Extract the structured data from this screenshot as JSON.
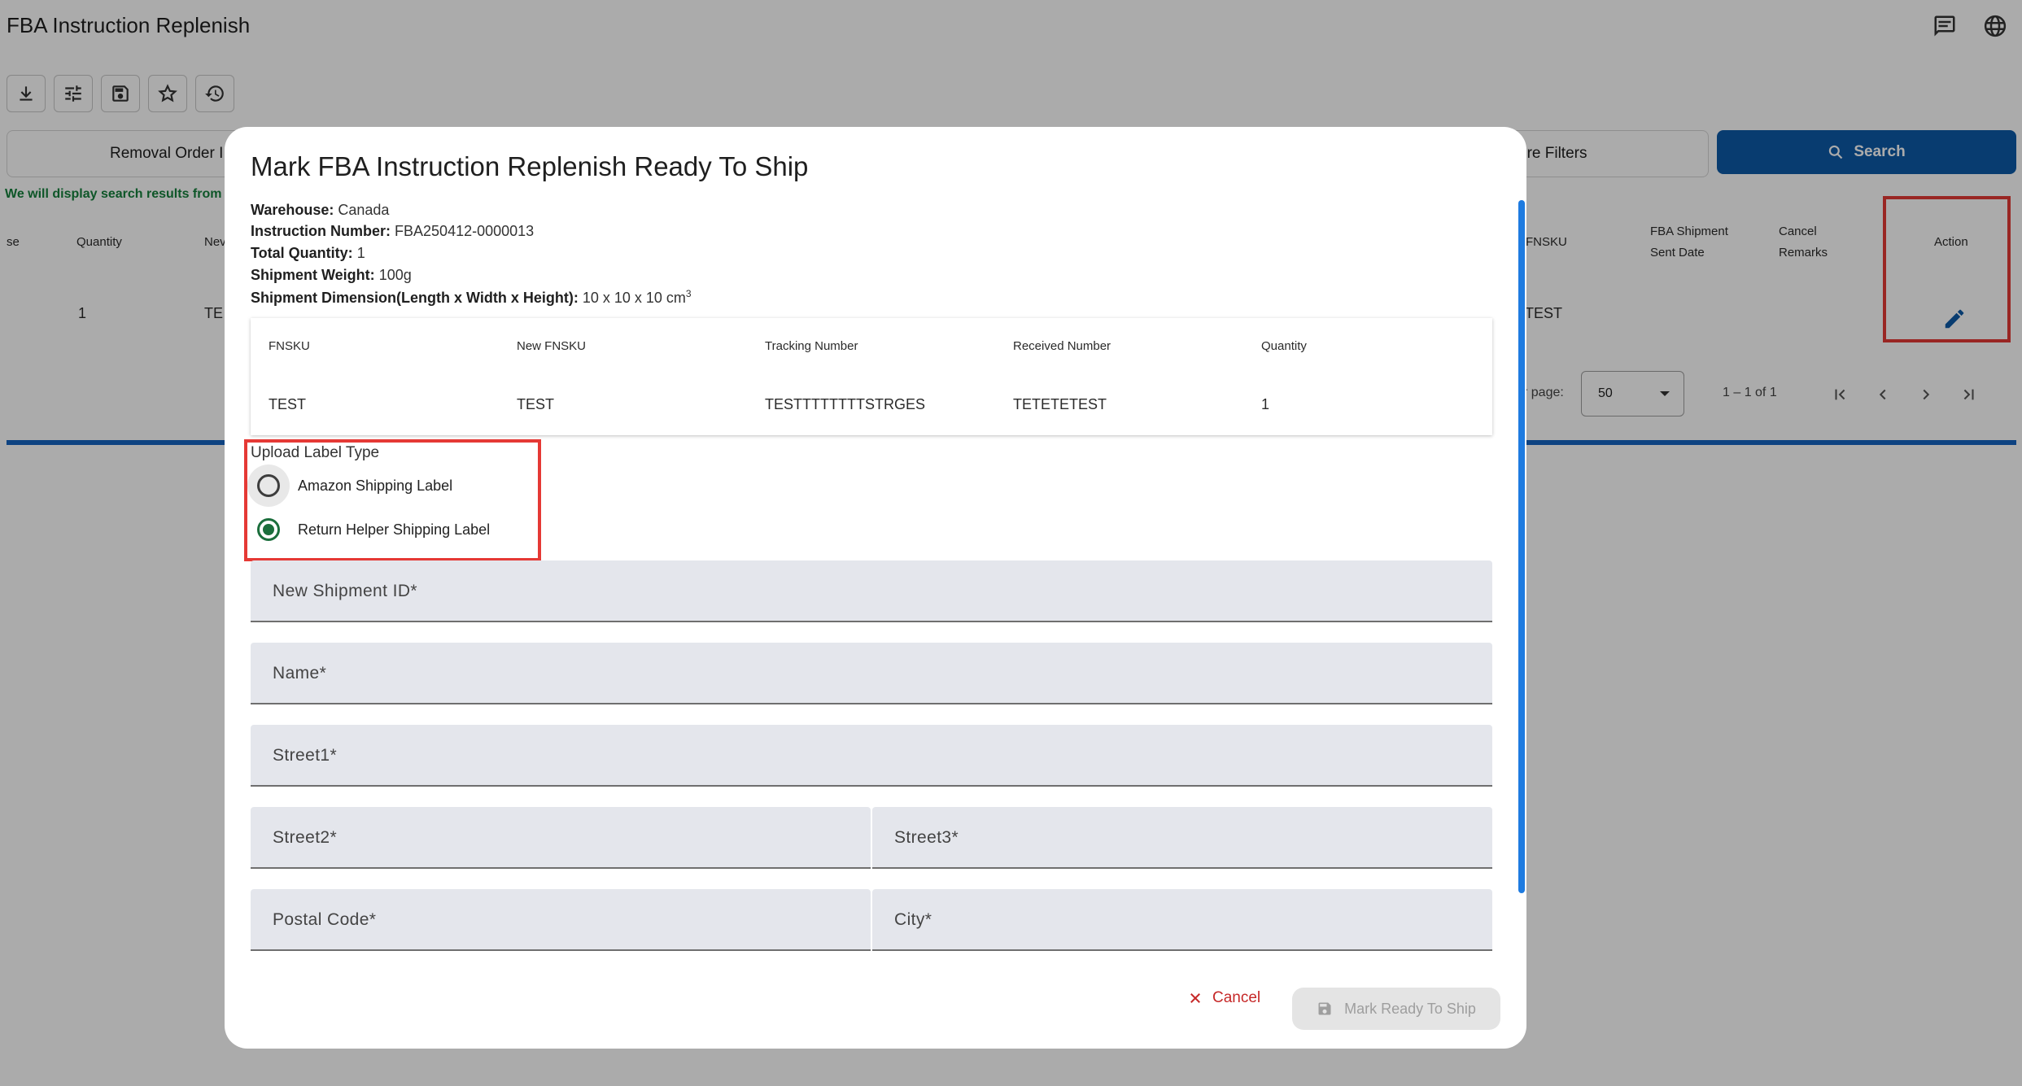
{
  "app": {
    "title": "FBA Instruction Replenish"
  },
  "header_icons": [
    "chat-icon",
    "globe-icon"
  ],
  "toolbar": {
    "buttons": [
      "download-icon",
      "filter-settings-icon",
      "save-icon",
      "star-icon",
      "history-icon"
    ]
  },
  "filters": {
    "left_tab_label": "Removal Order I",
    "right_tab_label": "ore Filters",
    "search_label": "Search"
  },
  "notice": "We will display search results from",
  "table": {
    "headers": {
      "col_se": "se",
      "quantity": "Quantity",
      "new": "Nev",
      "fnsku": "FNSKU",
      "fba_shipment_sent_date_1": "FBA Shipment",
      "fba_shipment_sent_date_2": "Sent Date",
      "cancel_remarks_1": "Cancel",
      "cancel_remarks_2": "Remarks",
      "action": "Action"
    },
    "row": {
      "quantity": "1",
      "new": "TE",
      "fnsku": "TEST"
    }
  },
  "pager": {
    "label": "r page:",
    "page_size": "50",
    "range": "1 – 1 of 1"
  },
  "dialog": {
    "title": "Mark FBA Instruction Replenish Ready To Ship",
    "info": {
      "warehouse_label": "Warehouse:",
      "warehouse": "Canada",
      "instruction_label": "Instruction Number:",
      "instruction": "FBA250412-0000013",
      "total_qty_label": "Total Quantity:",
      "total_qty": "1",
      "weight_label": "Shipment Weight:",
      "weight": "100g",
      "dimension_label": "Shipment Dimension(Length x Width x Height):",
      "dimension": "10 x 10 x 10 cm",
      "dimension_sup": "3"
    },
    "items_table": {
      "headers": [
        "FNSKU",
        "New FNSKU",
        "Tracking Number",
        "Received Number",
        "Quantity"
      ],
      "rows": [
        [
          "TEST",
          "TEST",
          "TESTTTTTTTTSTRGES",
          "TETETETEST",
          "1"
        ]
      ]
    },
    "label_type": {
      "group_label": "Upload Label Type",
      "options": [
        {
          "label": "Amazon Shipping Label",
          "selected": false
        },
        {
          "label": "Return Helper Shipping Label",
          "selected": true
        }
      ]
    },
    "fields": {
      "shipment_id": "New Shipment ID*",
      "name": "Name*",
      "street1": "Street1*",
      "street2": "Street2*",
      "street3": "Street3*",
      "postal_code": "Postal Code*",
      "city": "City*"
    },
    "actions": {
      "cancel": "Cancel",
      "mark_ready": "Mark Ready To Ship"
    }
  },
  "colors": {
    "primary": "#0d5aa7",
    "accent_blue": "#1e7be0",
    "radio_selected": "#1b6e3c",
    "cancel": "#c62828",
    "highlight_box": "#e53935",
    "notice_green": "#15803d"
  }
}
